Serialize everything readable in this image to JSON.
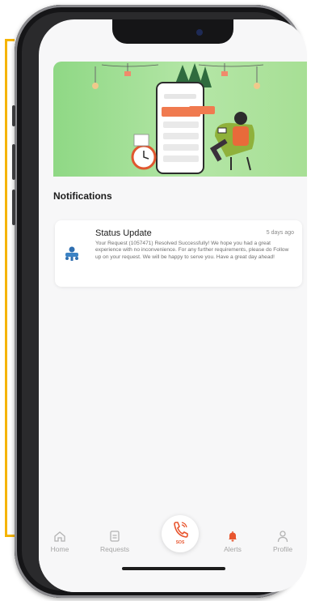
{
  "section_title": "Notifications",
  "notification": {
    "title": "Status Update",
    "time": "5 days ago",
    "message": "Your Request (1057471) Resolved Successfully! We hope you had a great experience with no inconvenience. For any further requirements, please do Follow up on your request. We will be happy to serve you. Have a great day ahead!"
  },
  "tabs": {
    "home": "Home",
    "requests": "Requests",
    "sos": "SOS",
    "alerts": "Alerts",
    "profile": "Profile"
  },
  "colors": {
    "accent": "#e8552e",
    "annotation": "#f5b400",
    "banner": "#a7df95"
  }
}
